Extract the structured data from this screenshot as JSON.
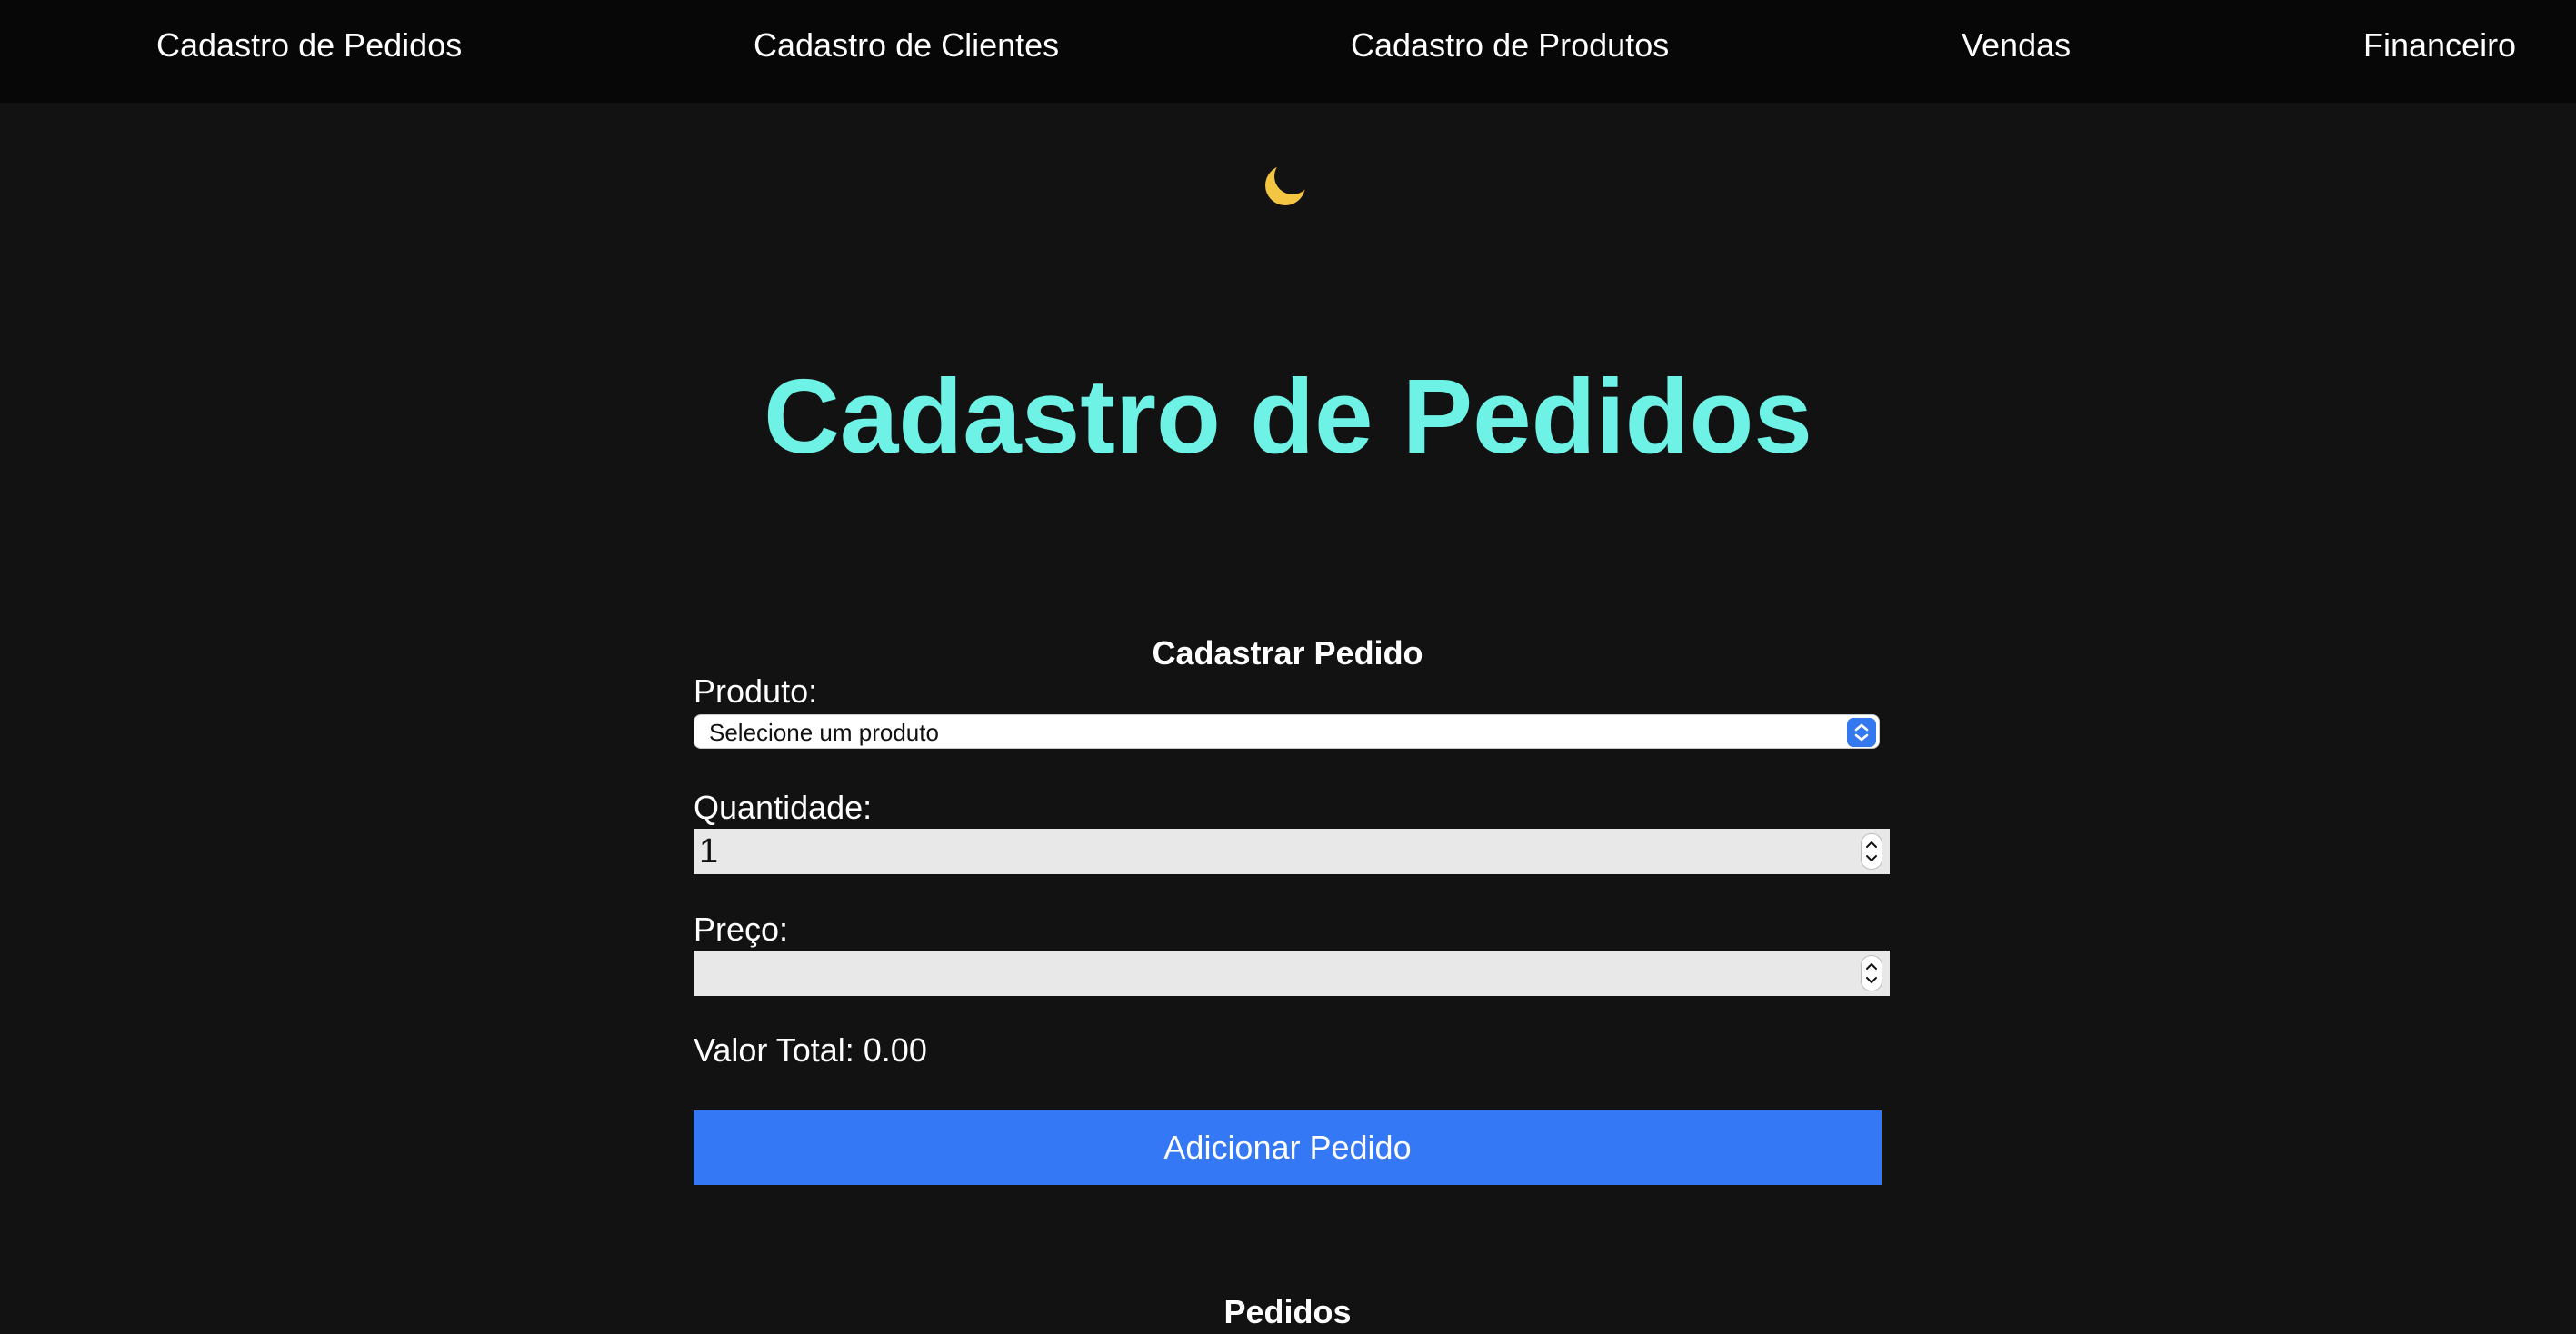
{
  "nav": {
    "items": [
      {
        "label": "Cadastro de Pedidos"
      },
      {
        "label": "Cadastro de Clientes"
      },
      {
        "label": "Cadastro de Produtos"
      },
      {
        "label": "Vendas"
      },
      {
        "label": "Financeiro"
      }
    ]
  },
  "theme_toggle": {
    "icon": "moon-icon",
    "color": "#f4c542"
  },
  "page": {
    "title": "Cadastro de Pedidos",
    "title_color": "#6ef2e6"
  },
  "form": {
    "heading": "Cadastrar Pedido",
    "produto_label": "Produto:",
    "produto_selected": "Selecione um produto",
    "quantidade_label": "Quantidade:",
    "quantidade_value": "1",
    "preco_label": "Preço:",
    "preco_value": "",
    "total_label": "Valor Total: 0.00",
    "submit_label": "Adicionar Pedido",
    "accent_color": "#3478f5"
  },
  "orders": {
    "heading": "Pedidos"
  }
}
